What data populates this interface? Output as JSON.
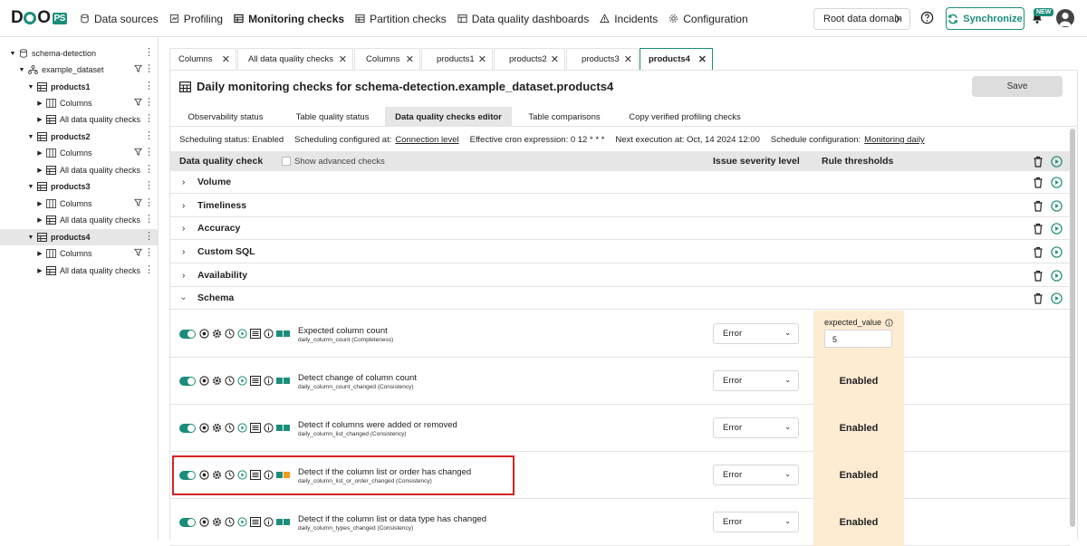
{
  "header": {
    "logo": "DQO",
    "logo_suffix": "PS",
    "nav": [
      {
        "label": "Data sources"
      },
      {
        "label": "Profiling"
      },
      {
        "label": "Monitoring checks"
      },
      {
        "label": "Partition checks"
      },
      {
        "label": "Data quality dashboards"
      },
      {
        "label": "Incidents"
      },
      {
        "label": "Configuration"
      }
    ],
    "root_domain": "Root data domain",
    "synchronize": "Synchronize",
    "new_badge": "NEW"
  },
  "tree": [
    {
      "label": "schema-detection"
    },
    {
      "label": "example_dataset"
    },
    {
      "label": "products1"
    },
    {
      "label": "Columns"
    },
    {
      "label": "All data quality checks"
    },
    {
      "label": "products2"
    },
    {
      "label": "Columns"
    },
    {
      "label": "All data quality checks"
    },
    {
      "label": "products3"
    },
    {
      "label": "Columns"
    },
    {
      "label": "All data quality checks"
    },
    {
      "label": "products4"
    },
    {
      "label": "Columns"
    },
    {
      "label": "All data quality checks"
    }
  ],
  "tabs": [
    {
      "label": "Columns"
    },
    {
      "label": "All data quality checks"
    },
    {
      "label": "Columns"
    },
    {
      "label": "products1"
    },
    {
      "label": "products2"
    },
    {
      "label": "products3"
    },
    {
      "label": "products4"
    }
  ],
  "panel": {
    "title": "Daily monitoring checks for schema-detection.example_dataset.products4",
    "save": "Save",
    "subtabs": [
      {
        "label": "Observability status"
      },
      {
        "label": "Table quality status"
      },
      {
        "label": "Data quality checks editor"
      },
      {
        "label": "Table comparisons"
      },
      {
        "label": "Copy verified profiling checks"
      }
    ],
    "schedule": {
      "status": "Scheduling status: Enabled",
      "configured_at_label": "Scheduling configured at:",
      "configured_at_link": "Connection level",
      "cron": "Effective cron expression: 0 12 * * *",
      "next": "Next execution at: Oct, 14 2024 12:00",
      "config_label": "Schedule configuration:",
      "config_link": "Monitoring daily"
    },
    "table_header": {
      "check": "Data quality check",
      "advanced": "Show advanced checks",
      "severity": "Issue severity level",
      "thresholds": "Rule thresholds"
    },
    "categories": [
      {
        "name": "Volume"
      },
      {
        "name": "Timeliness"
      },
      {
        "name": "Accuracy"
      },
      {
        "name": "Custom SQL"
      },
      {
        "name": "Availability"
      },
      {
        "name": "Schema"
      }
    ],
    "checks": [
      {
        "name": "Expected column count",
        "sub": "daily_column_count (Completeness)",
        "severity": "Error",
        "param_label": "expected_value",
        "param_value": "5"
      },
      {
        "name": "Detect change of column count",
        "sub": "daily_column_count_changed (Consistency)",
        "severity": "Error",
        "threshold": "Enabled"
      },
      {
        "name": "Detect if columns were added or removed",
        "sub": "daily_column_list_changed (Consistency)",
        "severity": "Error",
        "threshold": "Enabled"
      },
      {
        "name": "Detect if the column list or order has changed",
        "sub": "daily_column_list_or_order_changed (Consistency)",
        "severity": "Error",
        "threshold": "Enabled"
      },
      {
        "name": "Detect if the column list or data type has changed",
        "sub": "daily_column_types_changed (Consistency)",
        "severity": "Error",
        "threshold": "Enabled"
      }
    ]
  }
}
